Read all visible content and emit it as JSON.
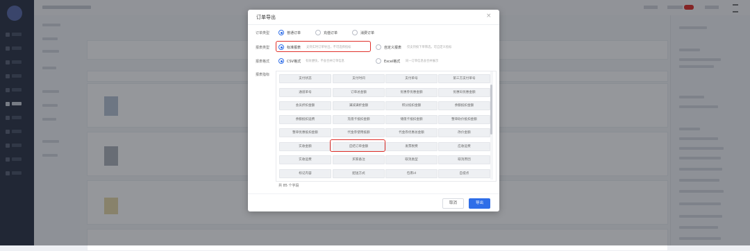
{
  "modal": {
    "title": "订单导出",
    "order_type": {
      "label": "订单类型",
      "options": [
        "普通订单",
        "充值订单",
        "消费订单"
      ],
      "selected": "普通订单"
    },
    "report_type": {
      "label": "报表类型",
      "standard_label": "标准报表",
      "standard_hint": "支持实时订单导出，不可选择指标",
      "custom_label": "自定义报表",
      "custom_hint": "仅支持按下单筛选，可自定义指标",
      "selected": "标准报表"
    },
    "report_format": {
      "label": "报表格式",
      "csv_label": "CSV格式",
      "csv_hint": "有效便快，不会合并订单信息",
      "excel_label": "Excel格式",
      "excel_hint": "同一订单信息会合并展示",
      "selected": "CSV格式"
    },
    "fields_label": "报表指标",
    "fields": [
      "支付状态",
      "支付时间",
      "支付单号",
      "第三方支付单号",
      "通道单号",
      "订单总金额",
      "优惠券优惠金额",
      "优惠码优惠金额",
      "会员折扣金额",
      "满减满折金额",
      "积分抵扣金额",
      "余额抵扣金额",
      "余额抵扣运费",
      "充值卡抵扣金额",
      "储值卡抵扣金额",
      "整单砍价抵扣金额",
      "整单优惠抵扣金额",
      "代金券使用抵额",
      "代金券优惠总金额",
      "改价金额",
      "实收金额",
      "应结订单金额",
      "发票税费",
      "应收运费",
      "实收运费",
      "买家备注",
      "取消类型",
      "取消原因",
      "标记内容",
      "配送方式",
      "包裹id",
      "自提点"
    ],
    "highlighted_field": "应结订单金额",
    "count_text": "共 85 个字段",
    "cancel_label": "取消",
    "export_label": "导出"
  },
  "colors": {
    "primary": "#2f6ee8",
    "highlight": "#e0302a",
    "sidebar": "#2d3445"
  }
}
